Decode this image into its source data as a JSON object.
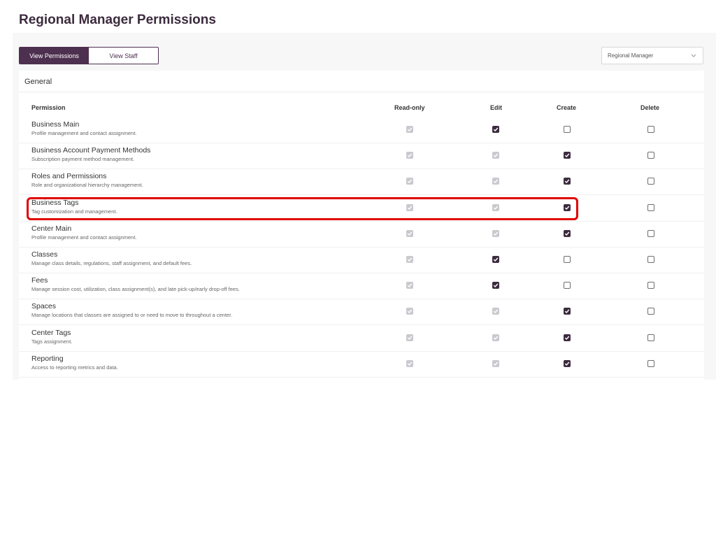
{
  "page": {
    "title": "Regional Manager Permissions"
  },
  "tabs": [
    {
      "label": "View Permissions",
      "active": true
    },
    {
      "label": "View Staff",
      "active": false
    }
  ],
  "role_select": {
    "value": "Regional Manager",
    "icon": "chevron-down-icon"
  },
  "section": {
    "title": "General"
  },
  "columns": {
    "permission": "Permission",
    "read_only": "Read-only",
    "edit": "Edit",
    "create": "Create",
    "delete": "Delete"
  },
  "rows": [
    {
      "name": "Business Main",
      "description": "Profile management and contact assignment.",
      "read_only": "disabled",
      "edit": "checked",
      "create": "empty",
      "delete": "empty"
    },
    {
      "name": "Business Account Payment Methods",
      "description": "Subscription payment method management.",
      "read_only": "disabled",
      "edit": "disabled",
      "create": "checked",
      "delete": "empty"
    },
    {
      "name": "Roles and Permissions",
      "description": "Role and organizational hierarchy management.",
      "read_only": "disabled",
      "edit": "disabled",
      "create": "checked",
      "delete": "empty"
    },
    {
      "name": "Business Tags",
      "description": "Tag customization and management.",
      "read_only": "disabled",
      "edit": "disabled",
      "create": "checked",
      "delete": "empty"
    },
    {
      "name": "Center Main",
      "description": "Profile management and contact assignment.",
      "read_only": "disabled",
      "edit": "disabled",
      "create": "checked",
      "delete": "empty"
    },
    {
      "name": "Classes",
      "description": "Manage class details, regulations, staff assignment, and default fees.",
      "read_only": "disabled",
      "edit": "checked",
      "create": "empty",
      "delete": "empty"
    },
    {
      "name": "Fees",
      "description": "Manage session cost, utilization, class assignment(s), and late pick-up/early drop-off fees.",
      "read_only": "disabled",
      "edit": "checked",
      "create": "empty",
      "delete": "empty"
    },
    {
      "name": "Spaces",
      "description": "Manage locations that classes are assigned to or need to move to throughout a center.",
      "read_only": "disabled",
      "edit": "disabled",
      "create": "checked",
      "delete": "empty"
    },
    {
      "name": "Center Tags",
      "description": "Tags assignment.",
      "read_only": "disabled",
      "edit": "disabled",
      "create": "checked",
      "delete": "empty"
    },
    {
      "name": "Reporting",
      "description": "Access to reporting metrics and data.",
      "read_only": "disabled",
      "edit": "disabled",
      "create": "checked",
      "delete": "empty"
    }
  ],
  "colors": {
    "brand": "#4d2f4f",
    "checked": "#3c2b3e",
    "disabled": "#c9c9cf",
    "highlight": "#e00000"
  }
}
